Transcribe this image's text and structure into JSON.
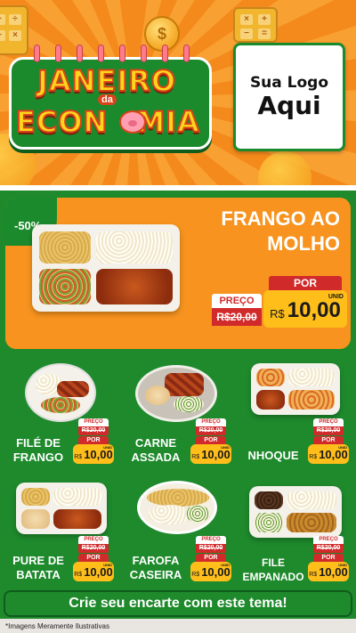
{
  "header": {
    "title_line1": "JANEIRO",
    "title_connector": "da",
    "title_line2": "ECONOMIA",
    "title_line2_a": "ECON",
    "title_line2_b": "MIA",
    "coin_symbol": "$",
    "logo_line1": "Sua Logo",
    "logo_line2": "Aqui"
  },
  "feature": {
    "discount": "-50%",
    "name": "FRANGO AO MOLHO",
    "old_label": "PREÇO",
    "old_price": "R$20,00",
    "new_label": "POR",
    "currency": "R$",
    "new_price": "10,00",
    "unit": "UNID"
  },
  "products": [
    {
      "name": "FILÉ DE FRANGO",
      "old_label": "PREÇO",
      "old_price": "R$20,00",
      "new_label": "POR",
      "currency": "R$",
      "new_price": "10,00",
      "unit": "UNID"
    },
    {
      "name": "CARNE ASSADA",
      "old_label": "PREÇO",
      "old_price": "R$20,00",
      "new_label": "POR",
      "currency": "R$",
      "new_price": "10,00",
      "unit": "UNID"
    },
    {
      "name": "NHOQUE",
      "old_label": "PREÇO",
      "old_price": "R$20,00",
      "new_label": "POR",
      "currency": "R$",
      "new_price": "10,00",
      "unit": "UNID"
    },
    {
      "name": "PURE DE BATATA",
      "old_label": "PREÇO",
      "old_price": "R$20,00",
      "new_label": "POR",
      "currency": "R$",
      "new_price": "10,00",
      "unit": "UNID"
    },
    {
      "name": "FAROFA CASEIRA",
      "old_label": "PREÇO",
      "old_price": "R$20,00",
      "new_label": "POR",
      "currency": "R$",
      "new_price": "10,00",
      "unit": "UNID"
    },
    {
      "name": "FILE EMPANADO",
      "old_label": "PREÇO",
      "old_price": "R$20,00",
      "new_label": "POR",
      "currency": "R$",
      "new_price": "10,00",
      "unit": "UNID"
    }
  ],
  "footer": {
    "cta": "Crie seu encarte com este tema!",
    "disclaimer": "*Imagens Meramente Ilustrativas"
  },
  "colors": {
    "green": "#1e8a2c",
    "orange": "#f7931e",
    "red": "#d12a2a",
    "yellow": "#ffbe1a"
  }
}
